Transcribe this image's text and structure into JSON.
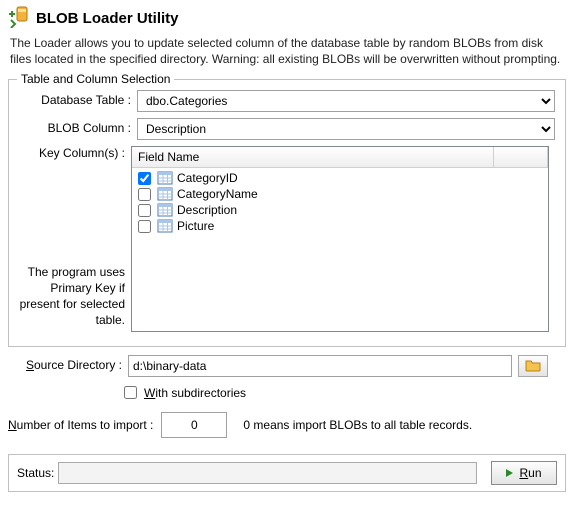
{
  "header": {
    "title": "BLOB Loader Utility",
    "description": "The Loader allows you to update selected column of the database table by random BLOBs from disk files located in the specified directory. Warning: all existing BLOBs will be overwritten without prompting."
  },
  "group": {
    "legend": "Table and Column Selection",
    "db_table_label": "Database Table :",
    "db_table_value": "dbo.Categories",
    "blob_col_label": "BLOB Column :",
    "blob_col_value": "Description",
    "key_cols_label": "Key Column(s) :",
    "key_cols_note": "The program uses Primary Key if present for selected table.",
    "field_header": "Field Name",
    "fields": [
      {
        "name": "CategoryID",
        "checked": true
      },
      {
        "name": "CategoryName",
        "checked": false
      },
      {
        "name": "Description",
        "checked": false
      },
      {
        "name": "Picture",
        "checked": false
      }
    ]
  },
  "source": {
    "label_pre": "S",
    "label_post": "ource Directory :",
    "value": "d:\\binary-data",
    "subdirs_pre": "W",
    "subdirs_post": "ith subdirectories",
    "subdirs_checked": false
  },
  "import": {
    "label_pre": "N",
    "label_post": "umber of Items to import :",
    "value": "0",
    "hint": "0 means import BLOBs to all table records."
  },
  "status": {
    "label": "Status:",
    "value": "",
    "run_pre": "R",
    "run_post": "un"
  }
}
